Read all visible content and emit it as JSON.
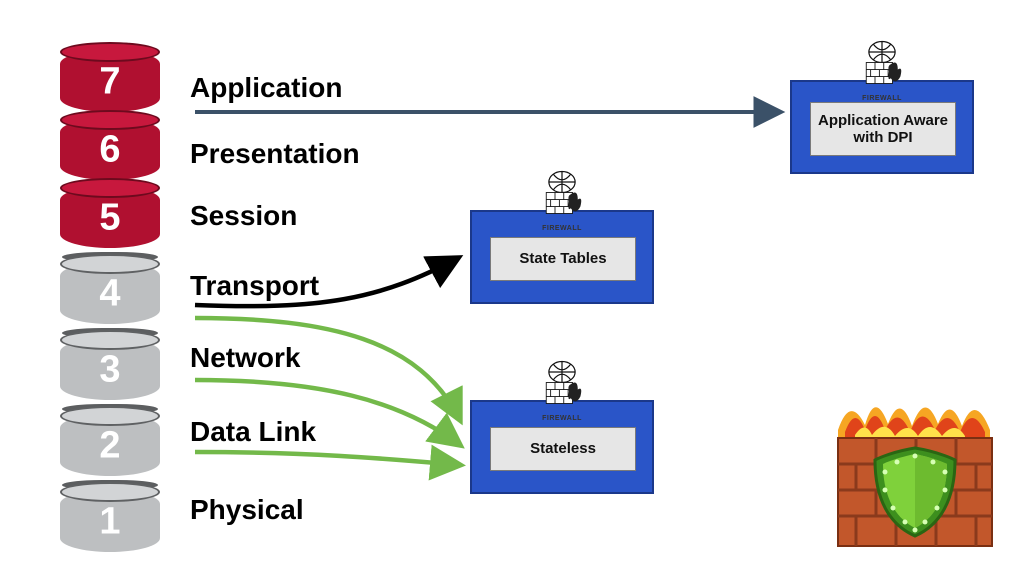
{
  "osi_layers": [
    {
      "num": "7",
      "name": "Application",
      "color": "red"
    },
    {
      "num": "6",
      "name": "Presentation",
      "color": "red"
    },
    {
      "num": "5",
      "name": "Session",
      "color": "red"
    },
    {
      "num": "4",
      "name": "Transport",
      "color": "grey"
    },
    {
      "num": "3",
      "name": "Network",
      "color": "grey"
    },
    {
      "num": "2",
      "name": "Data Link",
      "color": "grey"
    },
    {
      "num": "1",
      "name": "Physical",
      "color": "grey"
    }
  ],
  "firewall_boxes": {
    "app_aware": {
      "label": "Application Aware with DPI",
      "icon_caption": "FIREWALL"
    },
    "state_tables": {
      "label": "State Tables",
      "icon_caption": "FIREWALL"
    },
    "stateless": {
      "label": "Stateless",
      "icon_caption": "FIREWALL"
    }
  },
  "colors": {
    "red": "#b01030",
    "grey": "#bdbfc1",
    "blue": "#2a55c8",
    "arrow_dark": "#000000",
    "arrow_steel": "#3b5168",
    "arrow_green": "#73b94a",
    "brick": "#c2572b",
    "shield": "#6dbb2f"
  }
}
